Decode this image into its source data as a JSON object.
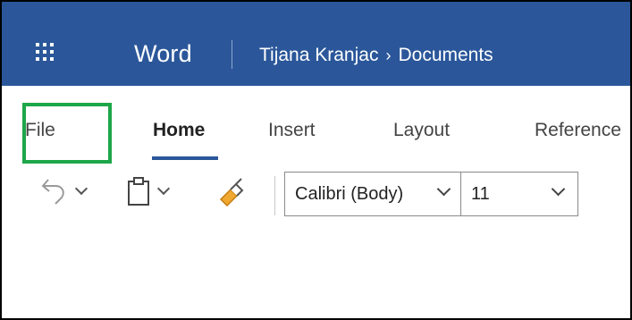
{
  "app": {
    "name": "Word",
    "breadcrumb": [
      "Tijana Kranjac",
      "Documents"
    ],
    "breadcrumb_separator": "›",
    "accent_color": "#2b579a",
    "highlight_color": "#1ea64a"
  },
  "tabs": [
    {
      "label": "File",
      "active": false,
      "highlighted": true
    },
    {
      "label": "Home",
      "active": true
    },
    {
      "label": "Insert",
      "active": false
    },
    {
      "label": "Layout",
      "active": false
    },
    {
      "label": "Reference",
      "active": false
    }
  ],
  "toolbar": {
    "undo_icon": "undo-icon",
    "paste_icon": "clipboard-icon",
    "format_painter_icon": "format-painter-icon",
    "font_name": "Calibri (Body)",
    "font_size": "11"
  }
}
